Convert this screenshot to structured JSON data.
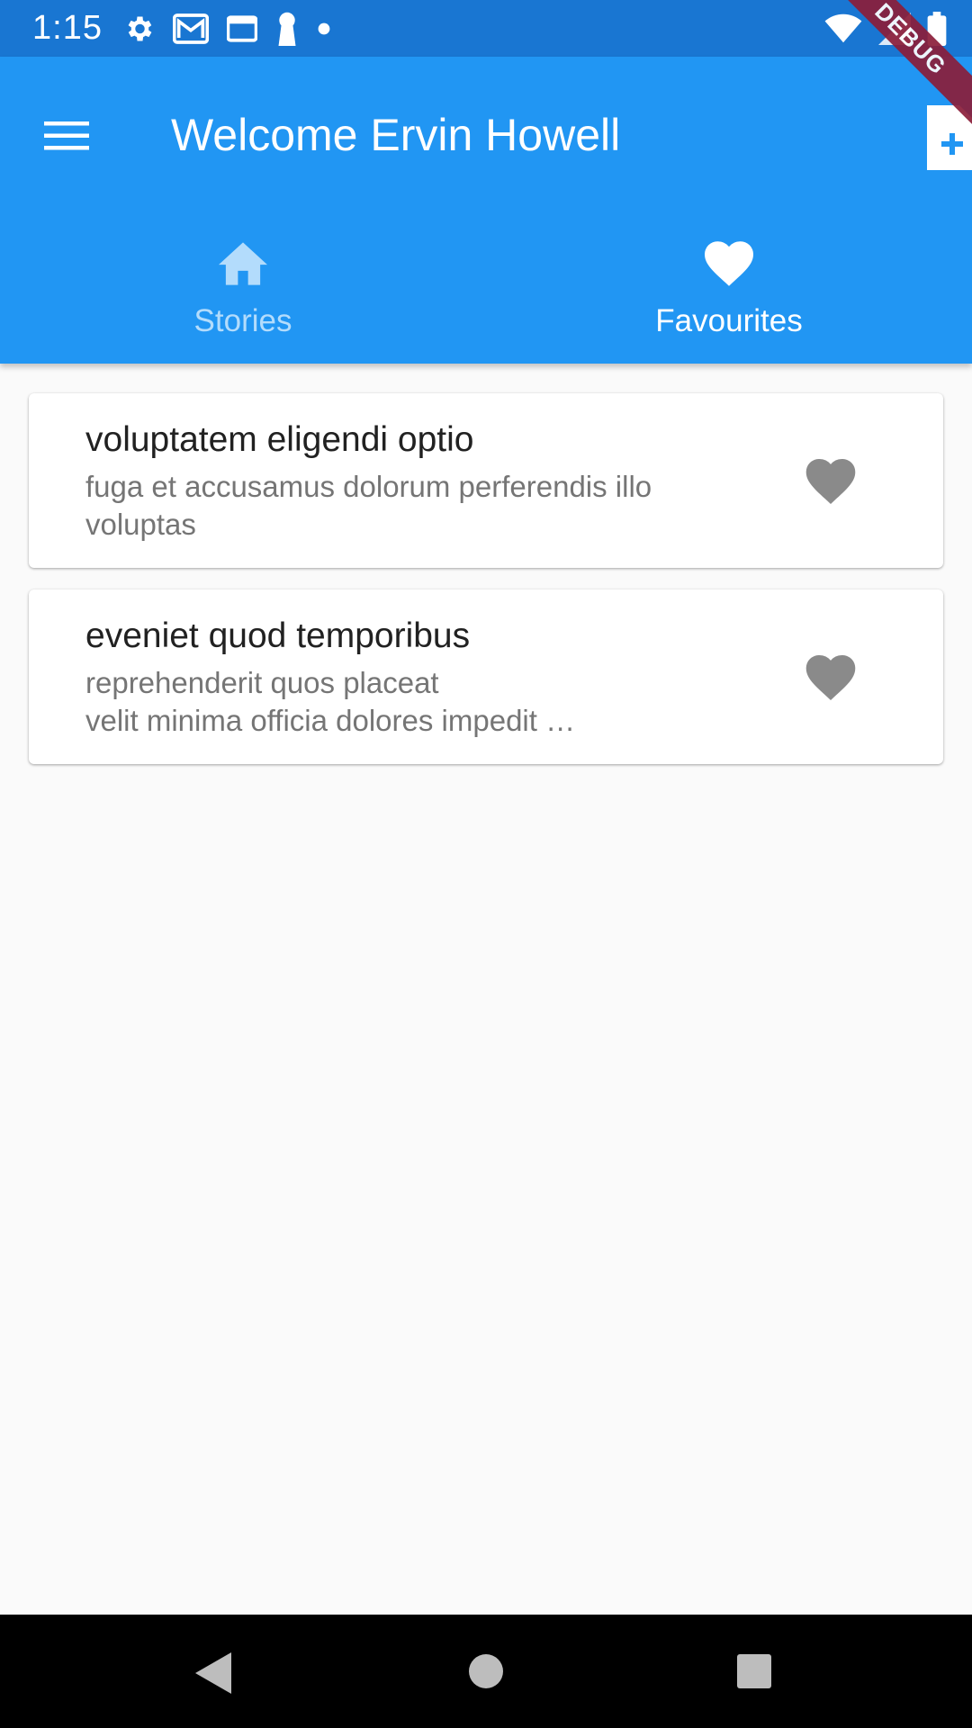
{
  "status_bar": {
    "time": "1:15",
    "left_icons": [
      "gear-icon",
      "gmail-icon",
      "sim-card-icon",
      "keyhole-icon",
      "dot-icon"
    ],
    "right_icons": [
      "wifi-icon",
      "cell-signal-icon",
      "battery-icon"
    ]
  },
  "debug_label": "DEBUG",
  "app_bar": {
    "title": "Welcome Ervin Howell",
    "menu_icon": "hamburger-menu-icon",
    "action_icon": "add-note-icon",
    "color": "#2196f3"
  },
  "tabs": [
    {
      "label": "Stories",
      "icon": "home-icon",
      "active": false
    },
    {
      "label": "Favourites",
      "icon": "heart-icon",
      "active": true
    }
  ],
  "stories": [
    {
      "title": "voluptatem eligendi optio",
      "subtitle": "fuga et accusamus dolorum perferendis illo\nvoluptas",
      "icon": "heart-icon"
    },
    {
      "title": "eveniet quod temporibus",
      "subtitle": "reprehenderit quos placeat\nvelit minima officia dolores impedit …",
      "icon": "heart-icon"
    }
  ],
  "nav_bar": {
    "icons": [
      "back-icon",
      "home-circle-icon",
      "recents-icon"
    ]
  }
}
